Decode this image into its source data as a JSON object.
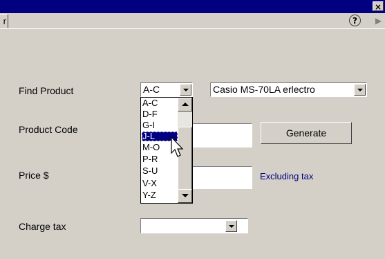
{
  "window": {
    "close_glyph": "×"
  },
  "tabs": {
    "fragment_label": "r",
    "help_glyph": "?",
    "scroll_right_glyph": "▶"
  },
  "form": {
    "find_product": {
      "label": "Find Product",
      "range_value": "A-C",
      "product_value": "Casio MS-70LA erlectro"
    },
    "product_code": {
      "label": "Product Code",
      "value": "",
      "button_label": "Generate"
    },
    "price": {
      "label": "Price $",
      "value": "",
      "note": "Excluding tax"
    },
    "charge_tax": {
      "label": "Charge tax",
      "value": ""
    }
  },
  "range_dropdown": {
    "options": [
      "A-C",
      "D-F",
      "G-I",
      "J-L",
      "M-O",
      "P-R",
      "S-U",
      "V-X",
      "Y-Z"
    ],
    "selected": "J-L"
  },
  "colors": {
    "titlebar": "#000080",
    "selection": "#000080",
    "note_text": "#000080",
    "face": "#d4d0c8"
  },
  "icons": [
    "close-icon",
    "help-icon",
    "scroll-right-icon",
    "chevron-down-icon",
    "scroll-up-icon",
    "scroll-down-icon",
    "mouse-pointer-icon"
  ]
}
